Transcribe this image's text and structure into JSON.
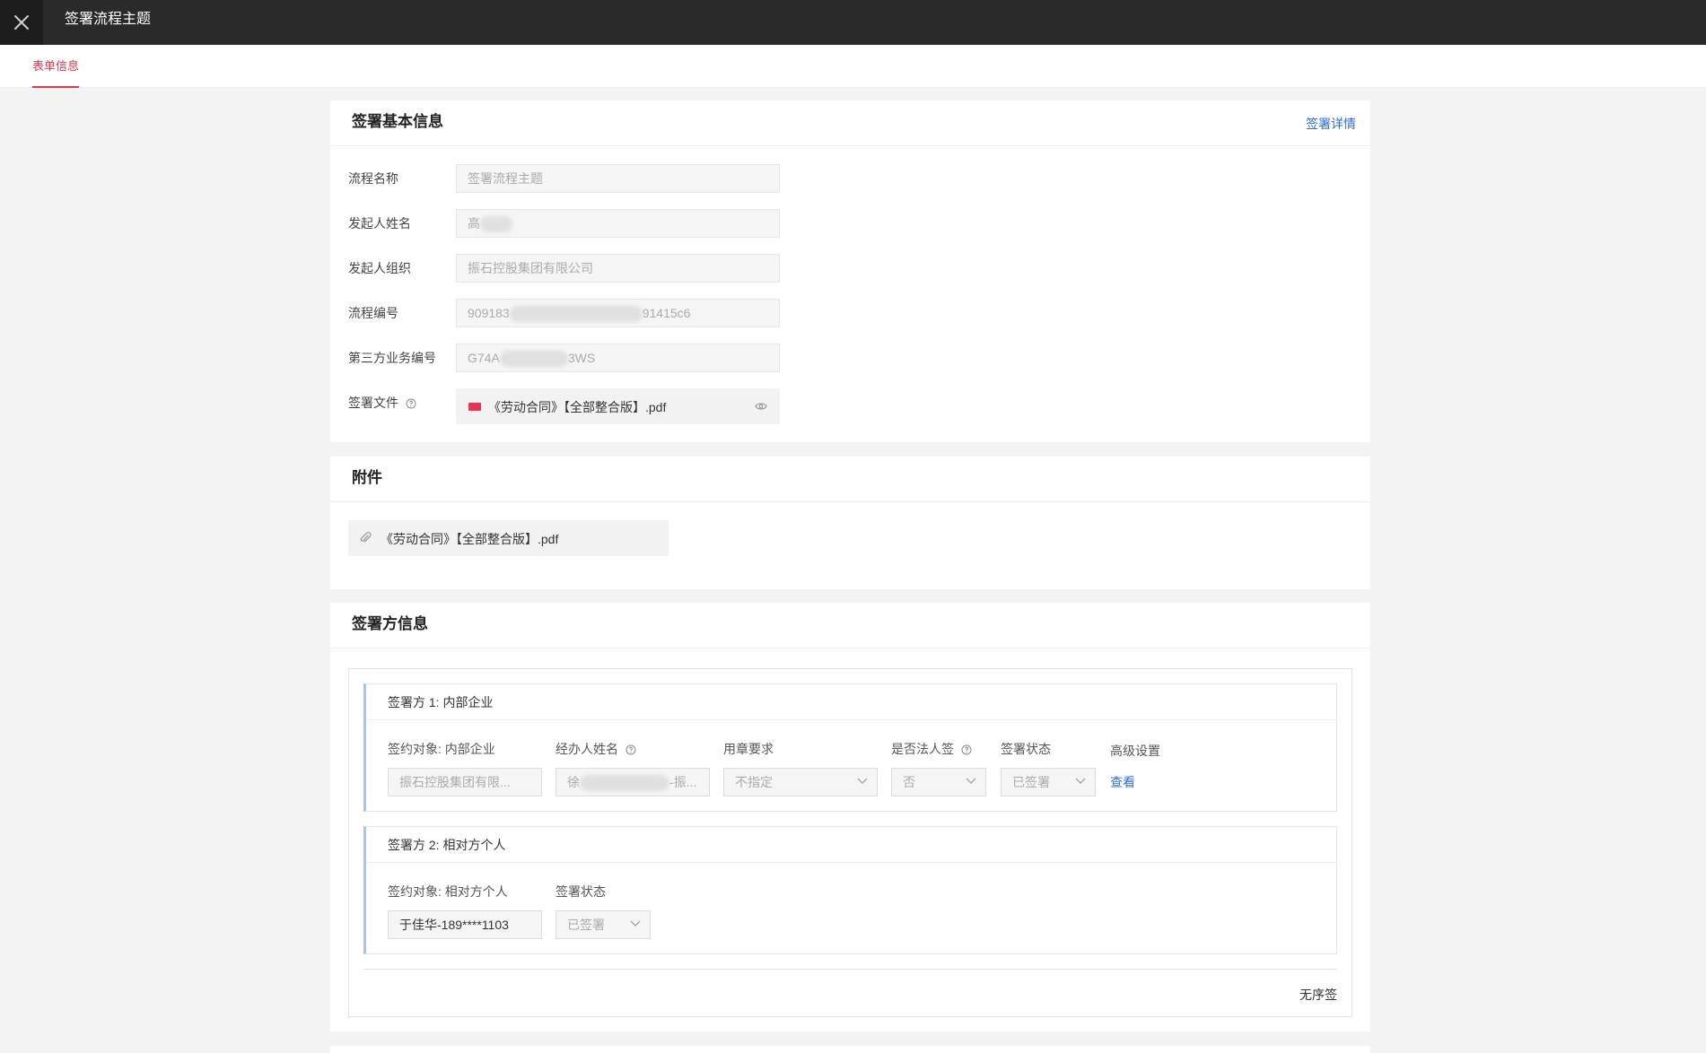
{
  "header": {
    "title": "签署流程主题",
    "close_icon": "close-icon"
  },
  "tabs": [
    {
      "label": "表单信息",
      "active": true
    }
  ],
  "basic": {
    "title": "签署基本信息",
    "detail_link": "签署详情",
    "fields": [
      {
        "label": "流程名称",
        "value": "签署流程主题"
      },
      {
        "label": "发起人姓名",
        "value_prefix": "高"
      },
      {
        "label": "发起人组织",
        "value": "振石控股集团有限公司"
      },
      {
        "label": "流程编号",
        "value_prefix": "909183",
        "value_suffix": "91415c6"
      },
      {
        "label": "第三方业务编号",
        "value_prefix": "G74A",
        "value_suffix": "3WS"
      }
    ],
    "file_label": "签署文件",
    "file_name": "《劳动合同》【全部整合版】.pdf"
  },
  "attachments": {
    "title": "附件",
    "file_name": "《劳动合同》【全部整合版】.pdf"
  },
  "signers": {
    "title": "签署方信息",
    "list": [
      {
        "title": "签署方 1:  内部企业",
        "target_label": "签约对象: 内部企业",
        "target_value": "振石控股集团有限...",
        "handler_label": "经办人姓名",
        "handler_prefix": "徐",
        "handler_suffix": "-振...",
        "seal_label": "用章要求",
        "seal_value": "不指定",
        "legal_label": "是否法人签",
        "legal_value": "否",
        "status_label": "签署状态",
        "status_value": "已签署",
        "advanced_label": "高级设置",
        "view_link": "查看"
      },
      {
        "title": "签署方 2:  相对方个人",
        "target_label": "签约对象: 相对方个人",
        "target_value": "于佳华-189****1103",
        "status_label": "签署状态",
        "status_value": "已签署"
      }
    ],
    "order_text": "无序签"
  }
}
